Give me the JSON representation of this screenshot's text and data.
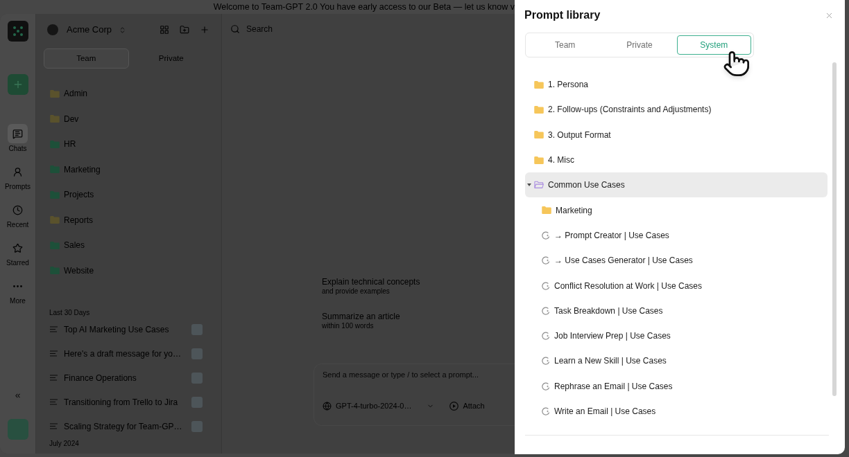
{
  "banner": {
    "text": "Welcome to Team-GPT 2.0 You have early access to our Beta — let us know v"
  },
  "rail": {
    "items": [
      {
        "label": "Chats",
        "selected": true
      },
      {
        "label": "Prompts",
        "selected": false
      },
      {
        "label": "Recent",
        "selected": false
      },
      {
        "label": "Starred",
        "selected": false
      },
      {
        "label": "More",
        "selected": false
      }
    ]
  },
  "sidebar": {
    "workspace": "Acme Corp",
    "tabs": [
      {
        "label": "Team",
        "selected": true
      },
      {
        "label": "Private",
        "selected": false
      }
    ],
    "folders": [
      {
        "name": "Admin",
        "color": "#5a522c"
      },
      {
        "name": "Dev",
        "color": "#5a522c"
      },
      {
        "name": "HR",
        "color": "#1d5039"
      },
      {
        "name": "Marketing",
        "color": "#1d5039"
      },
      {
        "name": "Projects",
        "color": "#1d5039"
      },
      {
        "name": "Reports",
        "color": "#5a522c"
      },
      {
        "name": "Sales",
        "color": "#1d5039"
      },
      {
        "name": "Website",
        "color": "#1d5039"
      }
    ],
    "sections": [
      {
        "label": "Last 30 Days",
        "chats": [
          {
            "title": "Top AI Marketing Use Cases"
          },
          {
            "title": "Here's a draft message for yo…"
          },
          {
            "title": "Finance Operations"
          },
          {
            "title": "Transitioning from Trello to Jira"
          },
          {
            "title": "Scaling Strategy for Team-GP…"
          }
        ]
      },
      {
        "label": "July 2024"
      }
    ]
  },
  "main": {
    "search": {
      "placeholder": "Search"
    },
    "suggestions": [
      {
        "title": "Explain technical concepts",
        "subtitle": "and provide examples"
      },
      {
        "title": "Summarize an article",
        "subtitle": "within 100 words"
      }
    ],
    "composer": {
      "placeholder": "Send a message or type / to select a prompt...",
      "model": "GPT-4-turbo-2024-0…",
      "attach": "Attach"
    }
  },
  "prompt_library": {
    "title": "Prompt library",
    "tabs": [
      {
        "label": "Team",
        "selected": false
      },
      {
        "label": "Private",
        "selected": false
      },
      {
        "label": "System",
        "selected": true
      }
    ],
    "tree": [
      {
        "kind": "folder",
        "name": "1. Persona",
        "expanded": false,
        "selected": false
      },
      {
        "kind": "folder",
        "name": "2. Follow-ups (Constraints and Adjustments)",
        "expanded": false,
        "selected": false
      },
      {
        "kind": "folder",
        "name": "3. Output Format",
        "expanded": false,
        "selected": false
      },
      {
        "kind": "folder",
        "name": "4. Misc",
        "expanded": false,
        "selected": false
      },
      {
        "kind": "folder",
        "name": "Common Use Cases",
        "expanded": true,
        "selected": true,
        "children": [
          {
            "kind": "folder",
            "name": "Marketing",
            "expanded": false,
            "selected": false
          },
          {
            "kind": "prompt",
            "name": "→ Prompt Creator | Use Cases",
            "selected": false
          },
          {
            "kind": "prompt",
            "name": "→ Use Cases Generator | Use Cases",
            "selected": false
          },
          {
            "kind": "prompt",
            "name": "Conflict Resolution at Work | Use Cases",
            "selected": false
          },
          {
            "kind": "prompt",
            "name": "Task Breakdown | Use Cases",
            "selected": false
          },
          {
            "kind": "prompt",
            "name": "Job Interview Prep | Use Cases",
            "selected": false
          },
          {
            "kind": "prompt",
            "name": "Learn a New Skill | Use Cases",
            "selected": false
          },
          {
            "kind": "prompt",
            "name": "Rephrase an Email | Use Cases",
            "selected": false
          },
          {
            "kind": "prompt",
            "name": "Write an Email | Use Cases",
            "selected": false
          }
        ]
      }
    ]
  }
}
